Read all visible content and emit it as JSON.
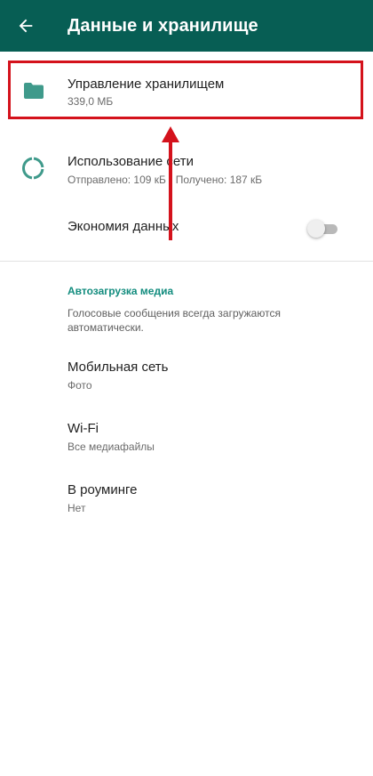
{
  "appbar": {
    "title": "Данные и хранилище",
    "color": "#075e54",
    "back_icon": "arrow-left-icon"
  },
  "storage": {
    "title": "Управление хранилищем",
    "subtitle": "339,0 МБ",
    "icon": "folder-icon",
    "highlighted": true,
    "highlight_color": "#d4121c"
  },
  "network": {
    "title": "Использование сети",
    "subtitle": "Отправлено: 109 кБ • Получено: 187 кБ",
    "icon": "data-usage-icon"
  },
  "data_saver": {
    "title": "Экономия данных",
    "enabled": false
  },
  "media_autodownload": {
    "header": "Автозагрузка медиа",
    "description": "Голосовые сообщения всегда загружаются автоматически.",
    "items": [
      {
        "title": "Мобильная сеть",
        "subtitle": "Фото"
      },
      {
        "title": "Wi-Fi",
        "subtitle": "Все медиафайлы"
      },
      {
        "title": "В роуминге",
        "subtitle": "Нет"
      }
    ]
  },
  "annotation": {
    "arrow_color": "#d4121c",
    "arrow_direction": "up"
  },
  "accent_color": "#128c7e"
}
